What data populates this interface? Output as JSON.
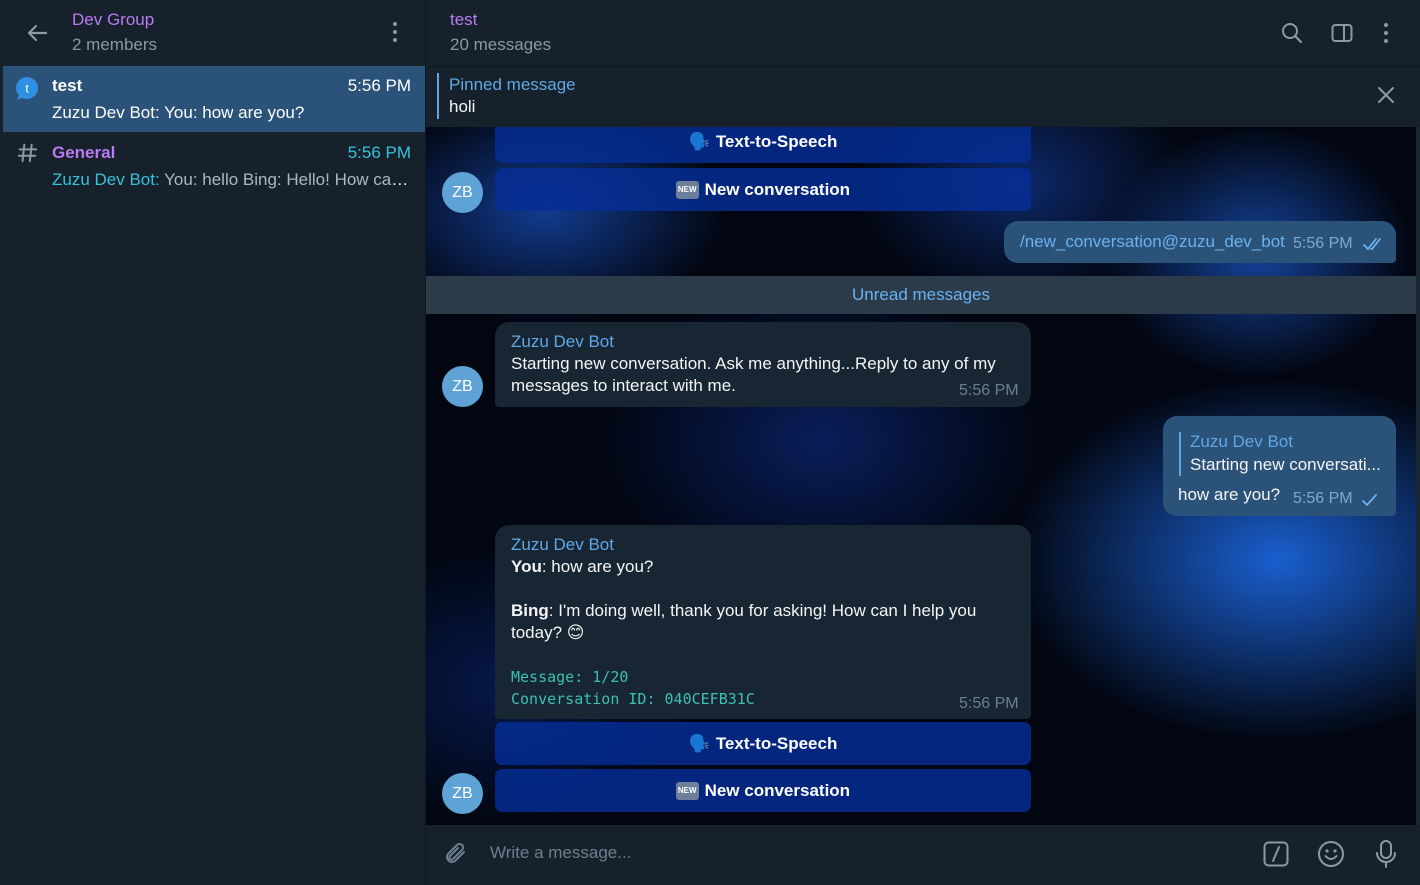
{
  "sidebar": {
    "group_title": "Dev Group",
    "group_subtitle": "2 members",
    "topics": [
      {
        "name": "test",
        "time": "5:56 PM",
        "preview": "Zuzu Dev Bot: You: how are you?",
        "icon_letter": "t",
        "active": true
      },
      {
        "name": "General",
        "time": "5:56 PM",
        "preview_sender": "Zuzu Dev Bot:",
        "preview_text": " You: hello  Bing: Hello! How can ...",
        "icon": "hash-icon"
      }
    ]
  },
  "chat": {
    "title": "test",
    "subtitle": "20 messages"
  },
  "pinned": {
    "label": "Pinned message",
    "text": "holi"
  },
  "messages": {
    "buttons_top": {
      "tts": "Text-to-Speech",
      "new_conv": "New conversation",
      "new_badge": "NEW"
    },
    "avatar_initials": "ZB",
    "sent_command": {
      "text": "/new_conversation@zuzu_dev_bot",
      "time": "5:56 PM"
    },
    "unread_label": "Unread messages",
    "bot_msg_1": {
      "sender": "Zuzu Dev Bot",
      "line1": "Starting new conversation. Ask me anything...Reply to any of my",
      "line2": "messages to interact with me.",
      "time": "5:56 PM"
    },
    "reply_out": {
      "quoted_sender": "Zuzu Dev Bot",
      "quoted_text": "Starting new conversati...",
      "text": "how are you?",
      "time": "5:56 PM"
    },
    "bot_msg_2": {
      "sender": "Zuzu Dev Bot",
      "you_label": "You",
      "you_text": ": how are you?",
      "bing_label": "Bing",
      "bing_text_1": ": I'm doing well, thank you for asking! How can I help you",
      "bing_text_2": "today? 😊",
      "mono_1": "Message: 1/20",
      "mono_2": "Conversation ID: 040CEFB31C",
      "time": "5:56 PM"
    },
    "buttons_bottom": {
      "tts": "Text-to-Speech",
      "new_conv": "New conversation",
      "new_badge": "NEW"
    }
  },
  "composer": {
    "placeholder": "Write a message..."
  },
  "colors": {
    "accent": "#5fa8e6",
    "group_title": "#b77bf0",
    "general_topic": "#b77bf0",
    "teal": "#3cc0b2",
    "active_topic_bg": "#2b5278"
  }
}
